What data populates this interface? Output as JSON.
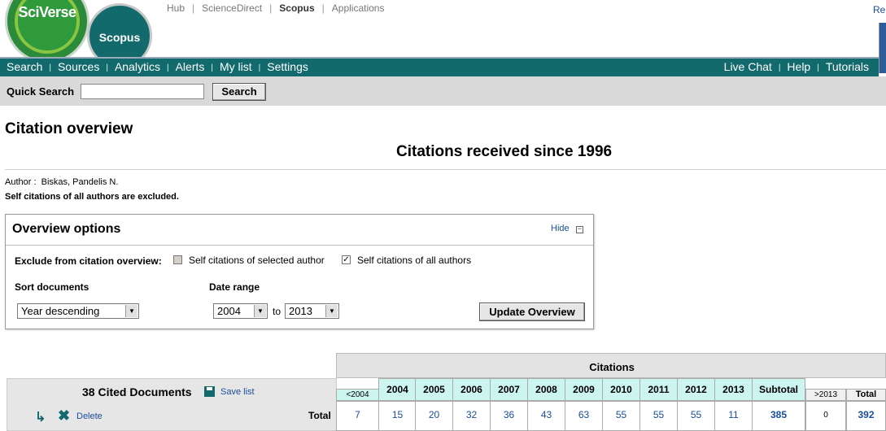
{
  "header": {
    "logo_primary": "SciVerse",
    "logo_secondary": "Scopus",
    "top_links": [
      "Hub",
      "ScienceDirect",
      "Scopus",
      "Applications"
    ],
    "active_link": "Scopus",
    "register_stub": "Re"
  },
  "nav": {
    "left": [
      "Search",
      "Sources",
      "Analytics",
      "Alerts",
      "My list",
      "Settings"
    ],
    "right": [
      "Live Chat",
      "Help",
      "Tutorials"
    ]
  },
  "quick_search": {
    "label": "Quick Search",
    "value": "",
    "button": "Search"
  },
  "page": {
    "title": "Citation overview",
    "subtitle": "Citations received since 1996",
    "author_label": "Author :",
    "author_name": "Biskas, Pandelis N.",
    "self_note": "Self citations of all authors are excluded."
  },
  "options": {
    "title": "Overview options",
    "hide": "Hide",
    "exclude_label": "Exclude from citation overview:",
    "checkbox_selected_author": {
      "label": "Self citations of selected author",
      "checked": false,
      "disabled": true
    },
    "checkbox_all_authors": {
      "label": "Self citations of all authors",
      "checked": true
    },
    "sort_label": "Sort documents",
    "sort_value": "Year descending",
    "date_label": "Date range",
    "date_from": "2004",
    "date_to": "2013",
    "to": "to",
    "update_button": "Update Overview"
  },
  "documents": {
    "count_label": "38 Cited Documents",
    "save_list": "Save list",
    "delete": "Delete",
    "total_label": "Total"
  },
  "citations": {
    "title": "Citations",
    "before_label": "<2004",
    "years": [
      "2004",
      "2005",
      "2006",
      "2007",
      "2008",
      "2009",
      "2010",
      "2011",
      "2012",
      "2013"
    ],
    "subtotal_label": "Subtotal",
    "after_label": ">2013",
    "total_label": "Total",
    "totals": {
      "before": "7",
      "years": [
        "15",
        "20",
        "32",
        "36",
        "43",
        "63",
        "55",
        "55",
        "55",
        "11"
      ],
      "subtotal": "385",
      "after": "0",
      "total": "392"
    }
  }
}
